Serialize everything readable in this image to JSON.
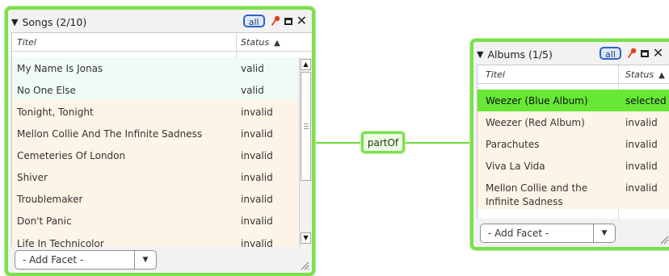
{
  "songs_panel": {
    "title": "Songs (2/10)",
    "all_label": "all",
    "columns": [
      "Titel",
      "Status"
    ],
    "sort_arrow": "▲",
    "rows": [
      {
        "title": "My Name Is Jonas",
        "status": "valid"
      },
      {
        "title": "No One Else",
        "status": "valid"
      },
      {
        "title": "Tonight, Tonight",
        "status": "invalid"
      },
      {
        "title": "Mellon Collie And The Infinite Sadness",
        "status": "invalid"
      },
      {
        "title": "Cemeteries Of London",
        "status": "invalid"
      },
      {
        "title": "Shiver",
        "status": "invalid"
      },
      {
        "title": "Troublemaker",
        "status": "invalid"
      },
      {
        "title": "Don't Panic",
        "status": "invalid"
      },
      {
        "title": "Life In Technicolor",
        "status": "invalid"
      }
    ],
    "add_facet_label": "- Add Facet -"
  },
  "relation": {
    "label": "partOf"
  },
  "albums_panel": {
    "title": "Albums (1/5)",
    "all_label": "all",
    "columns": [
      "Titel",
      "Status"
    ],
    "sort_arrow": "▲",
    "rows": [
      {
        "title": "Weezer (Blue Album)",
        "status": "selected"
      },
      {
        "title": "Weezer (Red Album)",
        "status": "invalid"
      },
      {
        "title": "Parachutes",
        "status": "invalid"
      },
      {
        "title": "Viva La Vida",
        "status": "invalid"
      },
      {
        "title_line1": "Mellon Collie and the",
        "title_line2": "Infinite Sadness",
        "status": "invalid"
      }
    ],
    "add_facet_label": "- Add Facet -"
  },
  "colors": {
    "panel_border": "#7be04c",
    "valid_row": "#f0fbf5",
    "invalid_row": "#fdf3e6",
    "selected_row": "#66e835",
    "all_button_border": "#2e64c2"
  },
  "icons": {
    "collapse": "collapse-triangle-icon",
    "pin": "pin-icon",
    "maximize": "maximize-icon",
    "close": "close-icon",
    "dropdown": "dropdown-arrow-icon",
    "resize": "resize-grip-icon"
  }
}
